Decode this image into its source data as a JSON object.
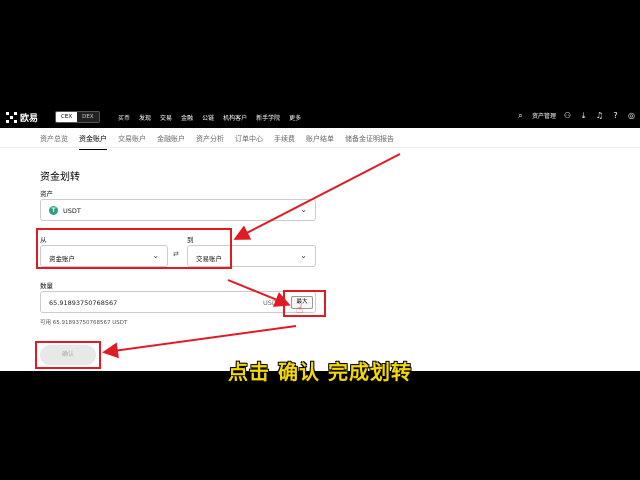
{
  "nav": {
    "logo_text": "欧易",
    "toggle": [
      "CEX",
      "DEX"
    ],
    "menu": [
      "买币",
      "发现",
      "交易",
      "金融",
      "公链",
      "机构客户",
      "新手学院",
      "更多"
    ],
    "asset_manage": "资产管理"
  },
  "tabs": [
    "资产总览",
    "资金账户",
    "交易账户",
    "金融账户",
    "资产分析",
    "订单中心",
    "手续费",
    "账户结单",
    "储备金证明报告"
  ],
  "form": {
    "title": "资金划转",
    "asset_label": "资产",
    "asset_value": "USDT",
    "from_label": "从",
    "from_value": "资金账户",
    "to_label": "到",
    "to_value": "交易账户",
    "qty_label": "数量",
    "qty_value": "65.91893750768567",
    "qty_unit": "USD",
    "max_label": "最大",
    "available_text": "可用 65.91893750768567 USDT",
    "confirm_label": "确认"
  },
  "subtitle": "点击 确认 完成划转",
  "colors": {
    "annotation_red": "#e01b24",
    "subtitle_yellow": "#f5d800",
    "usdt_green": "#26a17b"
  }
}
